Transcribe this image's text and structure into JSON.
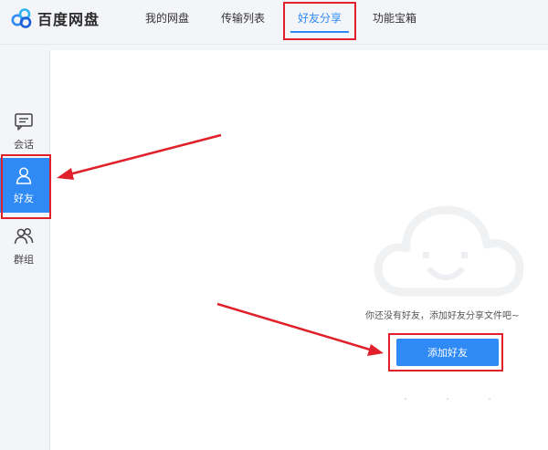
{
  "app": {
    "name": "百度网盘"
  },
  "nav": {
    "tabs": [
      {
        "label": "我的网盘",
        "active": false
      },
      {
        "label": "传输列表",
        "active": false
      },
      {
        "label": "好友分享",
        "active": true
      },
      {
        "label": "功能宝箱",
        "active": false
      }
    ]
  },
  "sidebar": {
    "items": [
      {
        "label": "会话",
        "icon": "chat-icon",
        "active": false
      },
      {
        "label": "好友",
        "icon": "user-icon",
        "active": true
      },
      {
        "label": "群组",
        "icon": "group-icon",
        "active": false
      }
    ]
  },
  "main": {
    "empty_state": {
      "illustration": "smiling-cloud-icon",
      "message": "你还没有好友，添加好友分享文件吧~",
      "button_label": "添加好友"
    }
  },
  "colors": {
    "accent": "#2f8af5",
    "annotation_red": "#e0202a",
    "background": "#f4f5f9",
    "main_background": "#ffffff"
  }
}
